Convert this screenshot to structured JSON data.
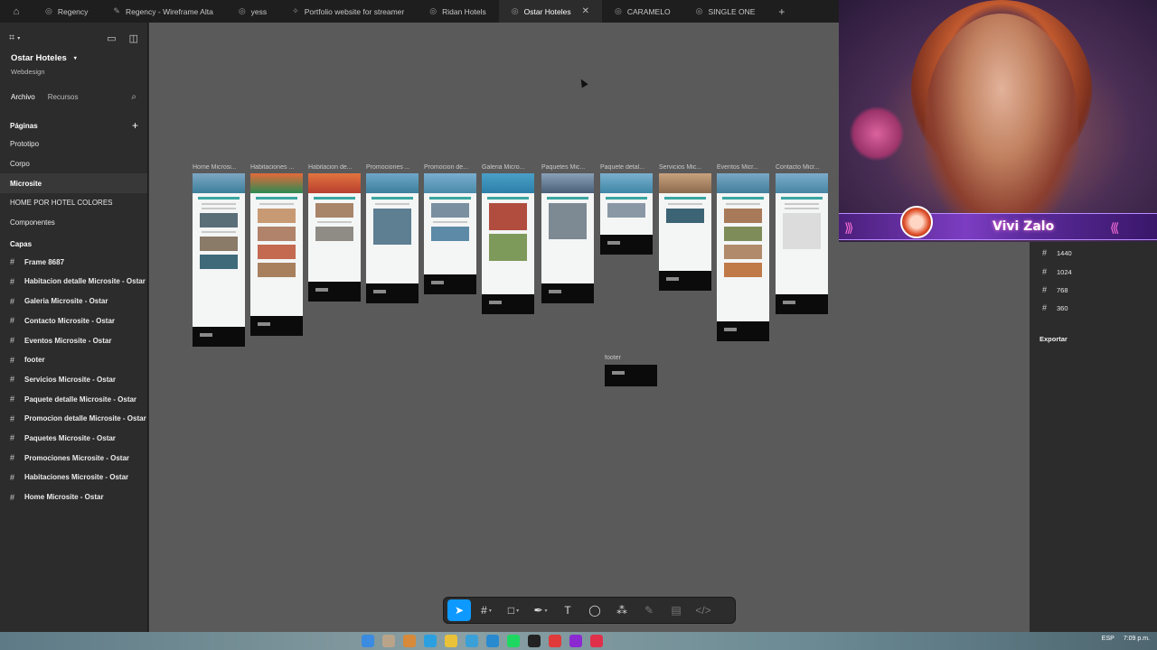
{
  "tabs": [
    {
      "label": "Regency",
      "icon": "globe-icon",
      "active": false
    },
    {
      "label": "Regency - Wireframe Alta",
      "icon": "pen-icon",
      "active": false
    },
    {
      "label": "yess",
      "icon": "globe-icon",
      "active": false
    },
    {
      "label": "Portfolio website for streamer",
      "icon": "component-icon",
      "active": false
    },
    {
      "label": "Ridan Hotels",
      "icon": "globe-icon",
      "active": false
    },
    {
      "label": "Ostar Hoteles",
      "icon": "globe-icon",
      "active": true
    },
    {
      "label": "CARAMELO",
      "icon": "globe-icon",
      "active": false
    },
    {
      "label": "SINGLE ONE",
      "icon": "globe-icon",
      "active": false
    }
  ],
  "sidebar": {
    "project_name": "Ostar Hoteles",
    "project_sub": "Webdesign",
    "tab_archivo": "Archivo",
    "tab_recursos": "Recursos",
    "pages_title": "Páginas",
    "pages": [
      "Prototipo",
      "Corpo",
      "Microsite",
      "HOME POR HOTEL COLORES",
      "Componentes"
    ],
    "selected_page": "Microsite",
    "layers_title": "Capas",
    "layers": [
      "Frame 8687",
      "Habitacion detalle Microsite - Ostar",
      "Galeria Microsite - Ostar",
      "Contacto Microsite - Ostar",
      "Eventos Microsite - Ostar",
      "footer",
      "Servicios Microsite - Ostar",
      "Paquete detalle Microsite - Ostar",
      "Promocion detalle Microsite - Ostar",
      "Paquetes Microsite - Ostar",
      "Promociones Microsite - Ostar",
      "Habitaciones Microsite - Ostar",
      "Home Microsite - Ostar"
    ]
  },
  "canvas": {
    "frame_labels": [
      "Home Microsi...",
      "Habitaciones ...",
      "Habitacion de...",
      "Promociones ...",
      "Promocion de...",
      "Galeria Micro...",
      "Paquetes Mic...",
      "Paquete detal...",
      "Servicios Mic...",
      "Eventos Micr...",
      "Contacto Micr..."
    ],
    "footer_label": "footer"
  },
  "right_panel": {
    "presets": [
      "1440",
      "1024",
      "768",
      "360"
    ],
    "export_label": "Exportar"
  },
  "webcam": {
    "streamer_name": "Vivi Zalo",
    "arrows_left": "⟩⟩⟩",
    "arrows_right": "⟨⟨⟨"
  },
  "taskbar": {
    "lang": "ESP",
    "time": "7:09 p.m."
  },
  "colors": {
    "accent": "#0d99ff",
    "canvas": "#5a5a5a",
    "panel": "#2c2c2c"
  }
}
